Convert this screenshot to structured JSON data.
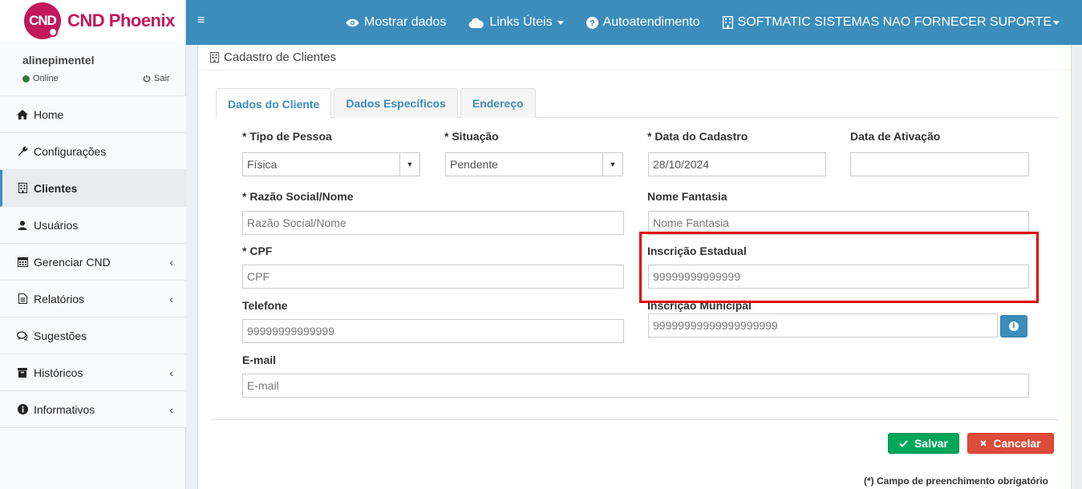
{
  "brand": {
    "logo_text": "CND",
    "name": "CND Phoenix"
  },
  "user": {
    "name": "alinepimentel",
    "status": "Online",
    "logout": "Sair"
  },
  "sidebar": {
    "items": [
      {
        "label": "Home",
        "icon": "home-icon"
      },
      {
        "label": "Configurações",
        "icon": "wrench-icon"
      },
      {
        "label": "Clientes",
        "icon": "building-icon"
      },
      {
        "label": "Usuários",
        "icon": "user-icon"
      },
      {
        "label": "Gerenciar CND",
        "icon": "calendar-icon"
      },
      {
        "label": "Relatórios",
        "icon": "document-icon"
      },
      {
        "label": "Sugestões",
        "icon": "comments-icon"
      },
      {
        "label": "Históricos",
        "icon": "archive-icon"
      },
      {
        "label": "Informativos",
        "icon": "info-icon"
      }
    ]
  },
  "navbar": {
    "menu_icon": "≡",
    "show_data": "Mostrar dados",
    "links": "Links Úteis",
    "self_service": "Autoatendimento",
    "company": "SOFTMATIC SISTEMAS NAO FORNECER SUPORTE"
  },
  "page": {
    "title": "Cadastro de Clientes"
  },
  "tabs": [
    "Dados do Cliente",
    "Dados Específicos",
    "Endereço"
  ],
  "form": {
    "tipo_pessoa": {
      "label": "* Tipo de Pessoa",
      "value": "Física"
    },
    "situacao": {
      "label": "* Situação",
      "value": "Pendente"
    },
    "data_cadastro": {
      "label": "* Data do Cadastro",
      "value": "28/10/2024"
    },
    "data_ativacao": {
      "label": "Data de Ativação",
      "value": ""
    },
    "razao_social": {
      "label": "* Razão Social/Nome",
      "placeholder": "Razão Social/Nome"
    },
    "nome_fantasia": {
      "label": "Nome Fantasia",
      "placeholder": "Nome Fantasia"
    },
    "cpf": {
      "label": "* CPF",
      "placeholder": "CPF"
    },
    "inscricao_estadual": {
      "label": "Inscrição Estadual",
      "placeholder": "99999999999999"
    },
    "telefone": {
      "label": "Telefone",
      "placeholder": "99999999999999"
    },
    "inscricao_municipal": {
      "label": "Inscrição Municipal",
      "placeholder": "99999999999999999999"
    },
    "email": {
      "label": "E-mail",
      "placeholder": "E-mail"
    }
  },
  "actions": {
    "save": "Salvar",
    "cancel": "Cancelar"
  },
  "footnote": "(*) Campo de preenchimento obrigatório",
  "colors": {
    "primary": "#3c8dbc",
    "brand": "#c2185b",
    "save": "#00a65a",
    "cancel": "#dd4b39",
    "highlight": "#e00000"
  }
}
